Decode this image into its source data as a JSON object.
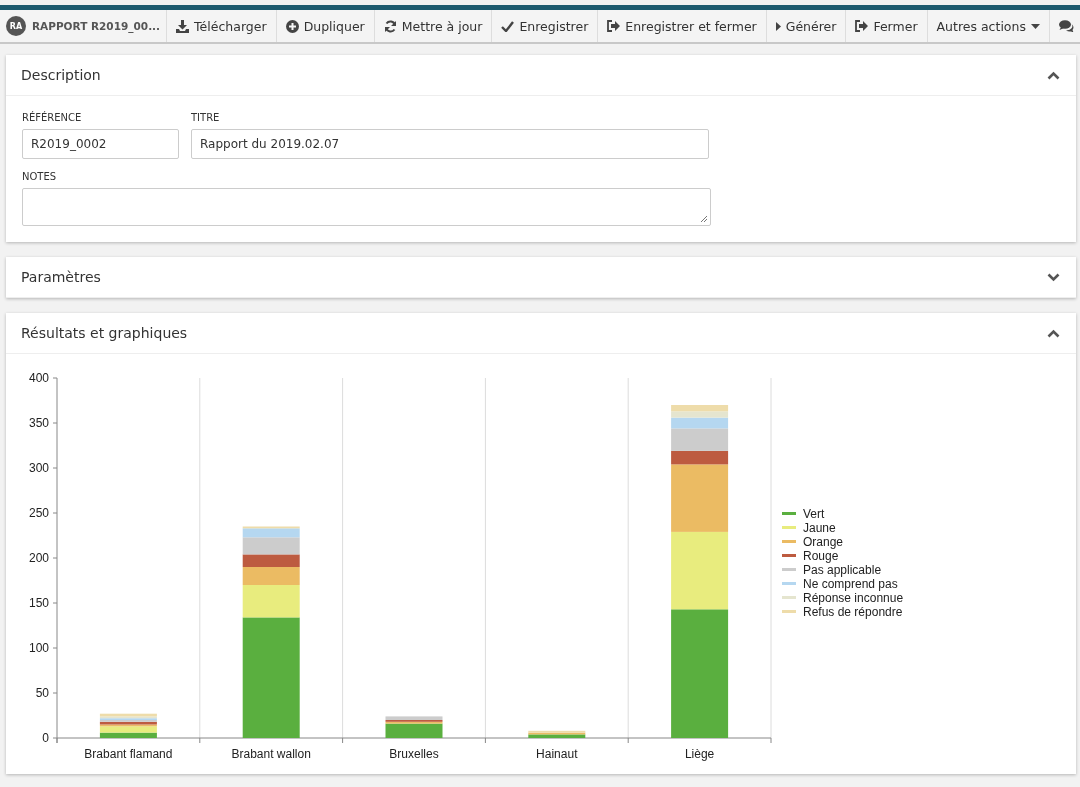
{
  "toolbar": {
    "record_badge": "RA",
    "record_title": "RAPPORT R2019_00...",
    "buttons": [
      {
        "kind": "download",
        "label": "Télécharger"
      },
      {
        "kind": "duplicate",
        "label": "Dupliquer"
      },
      {
        "kind": "refresh",
        "label": "Mettre à jour"
      },
      {
        "kind": "save",
        "label": "Enregistrer"
      },
      {
        "kind": "exit",
        "label": "Enregistrer et fermer"
      },
      {
        "kind": "run",
        "label": "Générer"
      },
      {
        "kind": "exit",
        "label": "Fermer"
      },
      {
        "kind": "menu",
        "label": "Autres actions"
      },
      {
        "kind": "comments"
      }
    ]
  },
  "panels": [
    {
      "title": "Description",
      "expanded": true,
      "kind": "form",
      "fields": [
        {
          "label": "RÉFÉRENCE",
          "value": "R2019_0002"
        },
        {
          "label": "TITRE",
          "value": "Rapport du 2019.02.07"
        }
      ],
      "notes": {
        "label": "NOTES"
      }
    },
    {
      "title": "Paramètres",
      "expanded": false,
      "kind": "form"
    },
    {
      "title": "Résultats et graphiques",
      "expanded": true,
      "kind": "chart",
      "chart_data": {
        "type": "bar",
        "stacked": true,
        "legend": "right",
        "categories": [
          "Brabant flamand",
          "Brabant wallon",
          "Bruxelles",
          "Hainaut",
          "Liège"
        ],
        "ylim": [
          0,
          400
        ],
        "yticks": [
          0,
          50,
          100,
          150,
          200,
          250,
          300,
          350,
          400
        ],
        "series": [
          {
            "name": "Vert",
            "color": "#5aaf3f",
            "values": [
              6,
              134,
              16,
              4,
              143
            ]
          },
          {
            "name": "Jaune",
            "color": "#e8ec7e",
            "values": [
              7,
              36,
              0,
              0,
              86
            ]
          },
          {
            "name": "Orange",
            "color": "#ebbb63",
            "values": [
              2,
              20,
              2,
              2,
              75
            ]
          },
          {
            "name": "Rouge",
            "color": "#bd5b40",
            "values": [
              3,
              14,
              2,
              0,
              15
            ]
          },
          {
            "name": "Pas applicable",
            "color": "#cccccc",
            "values": [
              2,
              19,
              4,
              0,
              25
            ]
          },
          {
            "name": "Ne comprend pas",
            "color": "#b5d7f0",
            "values": [
              2,
              10,
              0,
              0,
              12
            ]
          },
          {
            "name": "Réponse inconnue",
            "color": "#e5e5cf",
            "values": [
              2,
              0,
              0,
              0,
              7
            ]
          },
          {
            "name": "Refus de répondre",
            "color": "#eedcaa",
            "values": [
              3,
              2,
              0,
              2,
              7
            ]
          }
        ]
      }
    }
  ]
}
